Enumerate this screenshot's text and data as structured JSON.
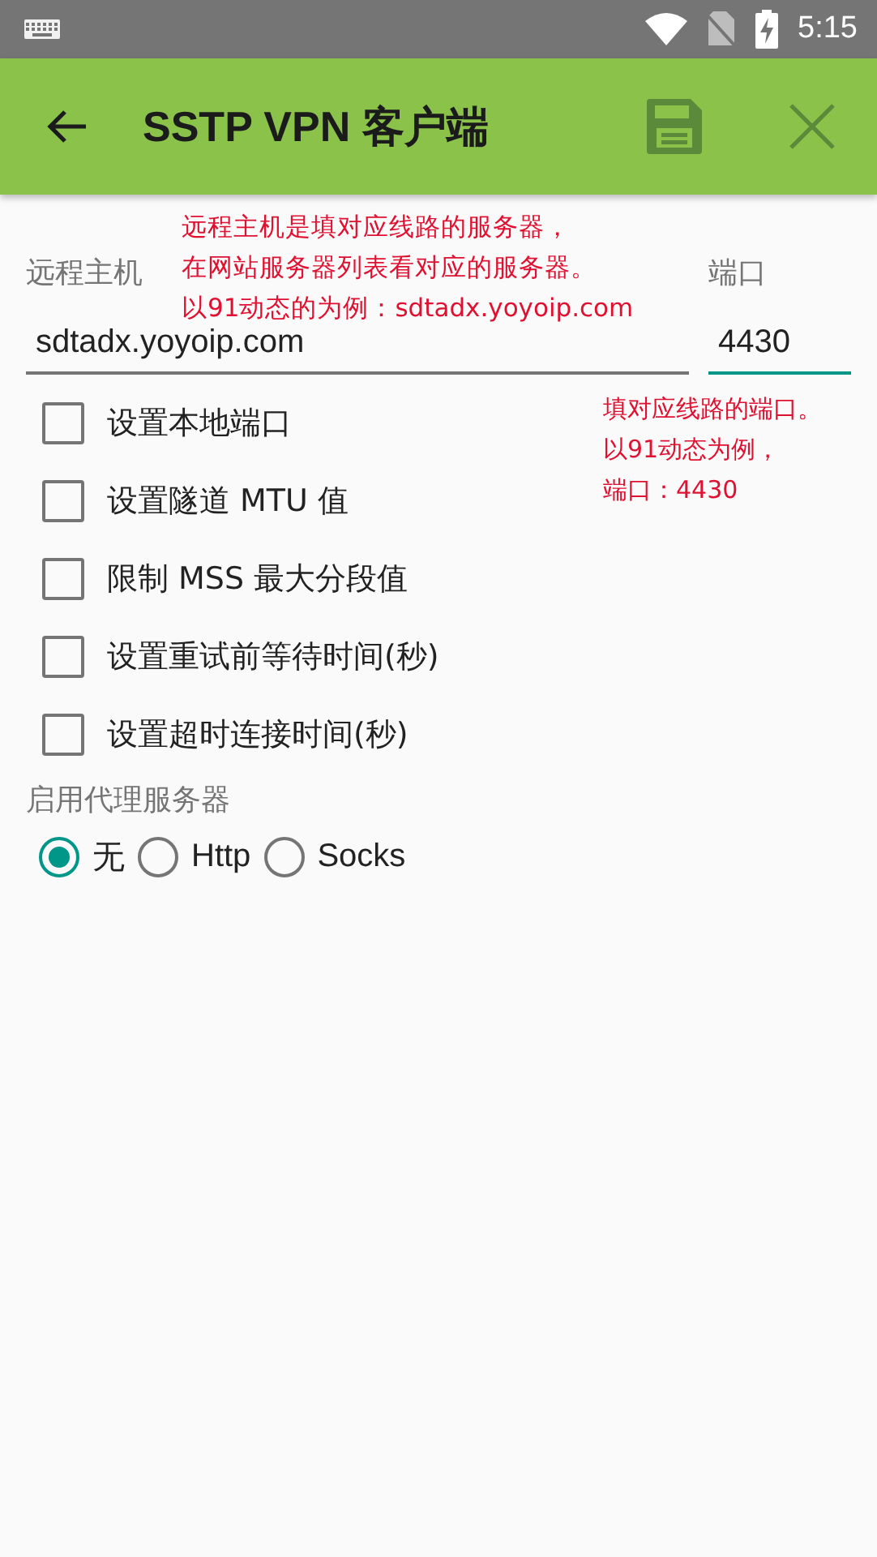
{
  "status_bar": {
    "time": "5:15"
  },
  "app_bar": {
    "title": "SSTP VPN 客户端"
  },
  "host": {
    "label": "远程主机",
    "value": "sdtadx.yoyoip.com"
  },
  "port": {
    "label": "端口",
    "value": "4430",
    "focused": true
  },
  "options": [
    {
      "label": "设置本地端口",
      "checked": false
    },
    {
      "label": "设置隧道 MTU 值",
      "checked": false
    },
    {
      "label": "限制 MSS 最大分段值",
      "checked": false
    },
    {
      "label": "设置重试前等待时间(秒)",
      "checked": false
    },
    {
      "label": "设置超时连接时间(秒)",
      "checked": false
    }
  ],
  "proxy": {
    "label": "启用代理服务器",
    "choices": [
      {
        "label": "无",
        "selected": true
      },
      {
        "label": "Http",
        "selected": false
      },
      {
        "label": "Socks",
        "selected": false
      }
    ]
  },
  "annotations": [
    {
      "kind": "host",
      "lines": [
        "远程主机是填对应线路的服务器，",
        "在网站服务器列表看对应的服务器。",
        "以91动态的为例：sdtadx.yoyoip.com"
      ]
    },
    {
      "kind": "port",
      "lines": [
        "填对应线路的端口。",
        "以91动态为例，",
        "端口：4430"
      ]
    }
  ]
}
